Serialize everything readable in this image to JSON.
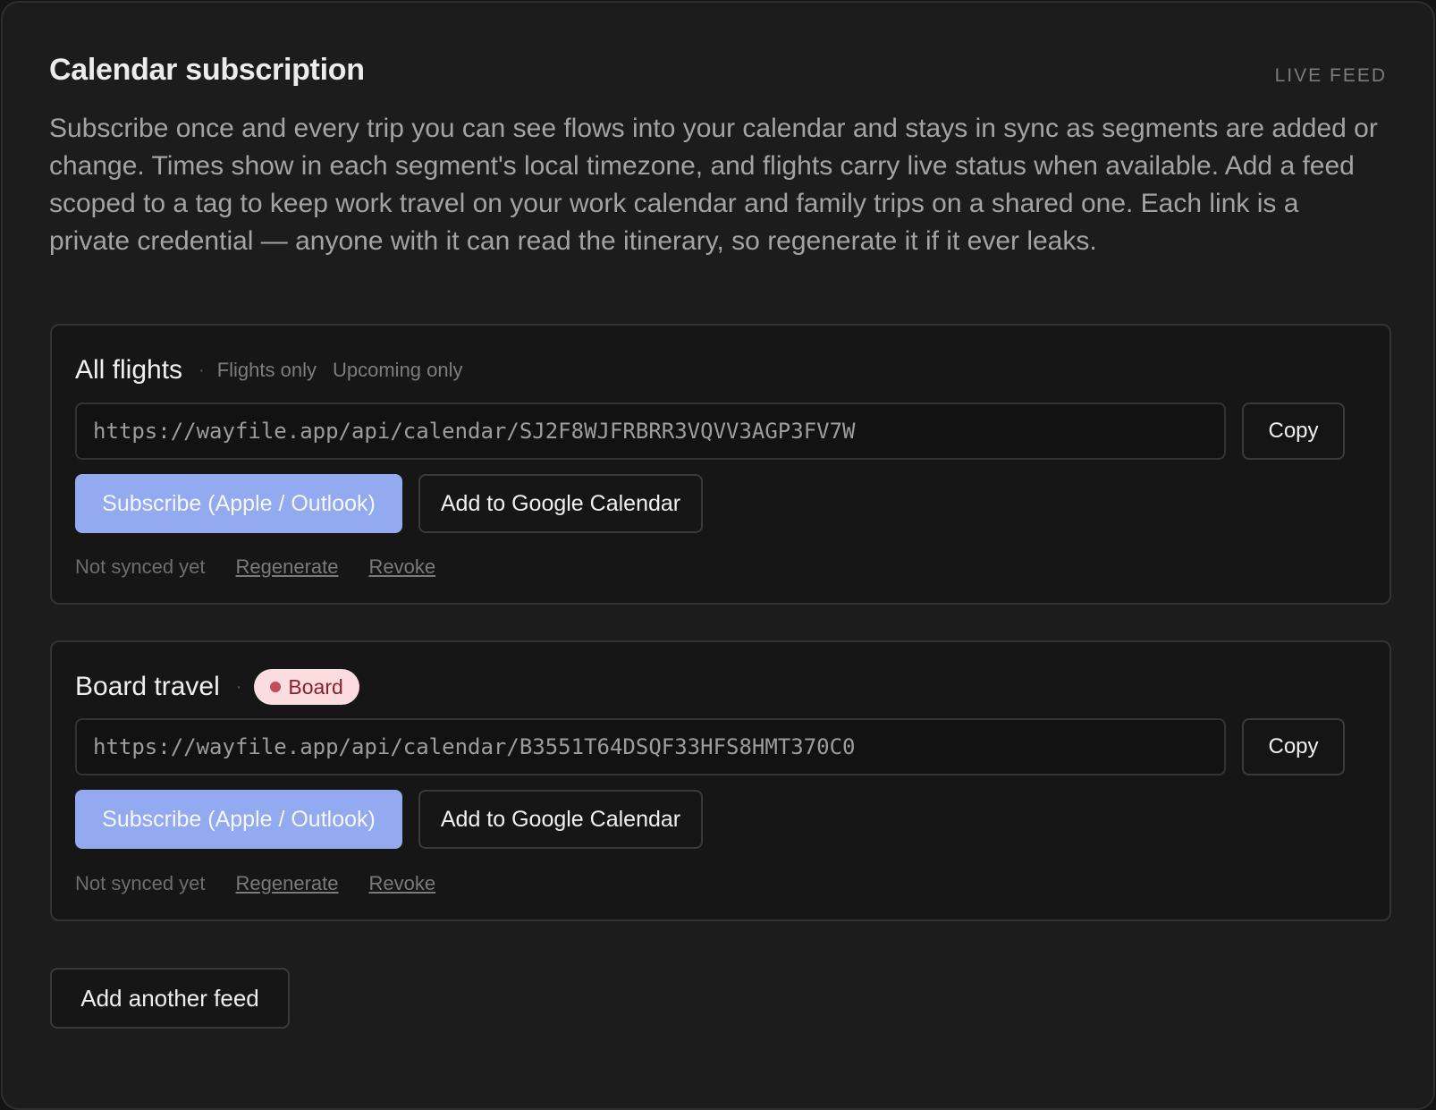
{
  "header": {
    "title": "Calendar subscription",
    "tag": "LIVE FEED"
  },
  "description": "Subscribe once and every trip you can see flows into your calendar and stays in sync as segments are added or change. Times show in each segment's local timezone, and flights carry live status when available. Add a feed scoped to a tag to keep work travel on your work calendar and family trips on a shared one. Each link is a private credential — anyone with it can read the itinerary, so regenerate it if it ever leaks.",
  "feeds": [
    {
      "title": "All flights",
      "separator": "·",
      "filters": [
        "Flights only",
        "Upcoming only"
      ],
      "url": "https://wayfile.app/api/calendar/SJ2F8WJFRBRR3VQVV3AGP3FV7W",
      "copy_label": "Copy",
      "subscribe_label": "Subscribe (Apple / Outlook)",
      "google_label": "Add to Google Calendar",
      "status": "Not synced yet",
      "regenerate_label": "Regenerate",
      "revoke_label": "Revoke"
    },
    {
      "title": "Board travel",
      "separator": "·",
      "badge": "Board",
      "badge_color": "#c54a5a",
      "url": "https://wayfile.app/api/calendar/B3551T64DSQF33HFS8HMT370C0",
      "copy_label": "Copy",
      "subscribe_label": "Subscribe (Apple / Outlook)",
      "google_label": "Add to Google Calendar",
      "status": "Not synced yet",
      "regenerate_label": "Regenerate",
      "revoke_label": "Revoke"
    }
  ],
  "add_feed_label": "Add another feed",
  "colors": {
    "accent": "#93a9f0",
    "badge_bg": "#fbdde0",
    "badge_text": "#8c1f2e"
  }
}
